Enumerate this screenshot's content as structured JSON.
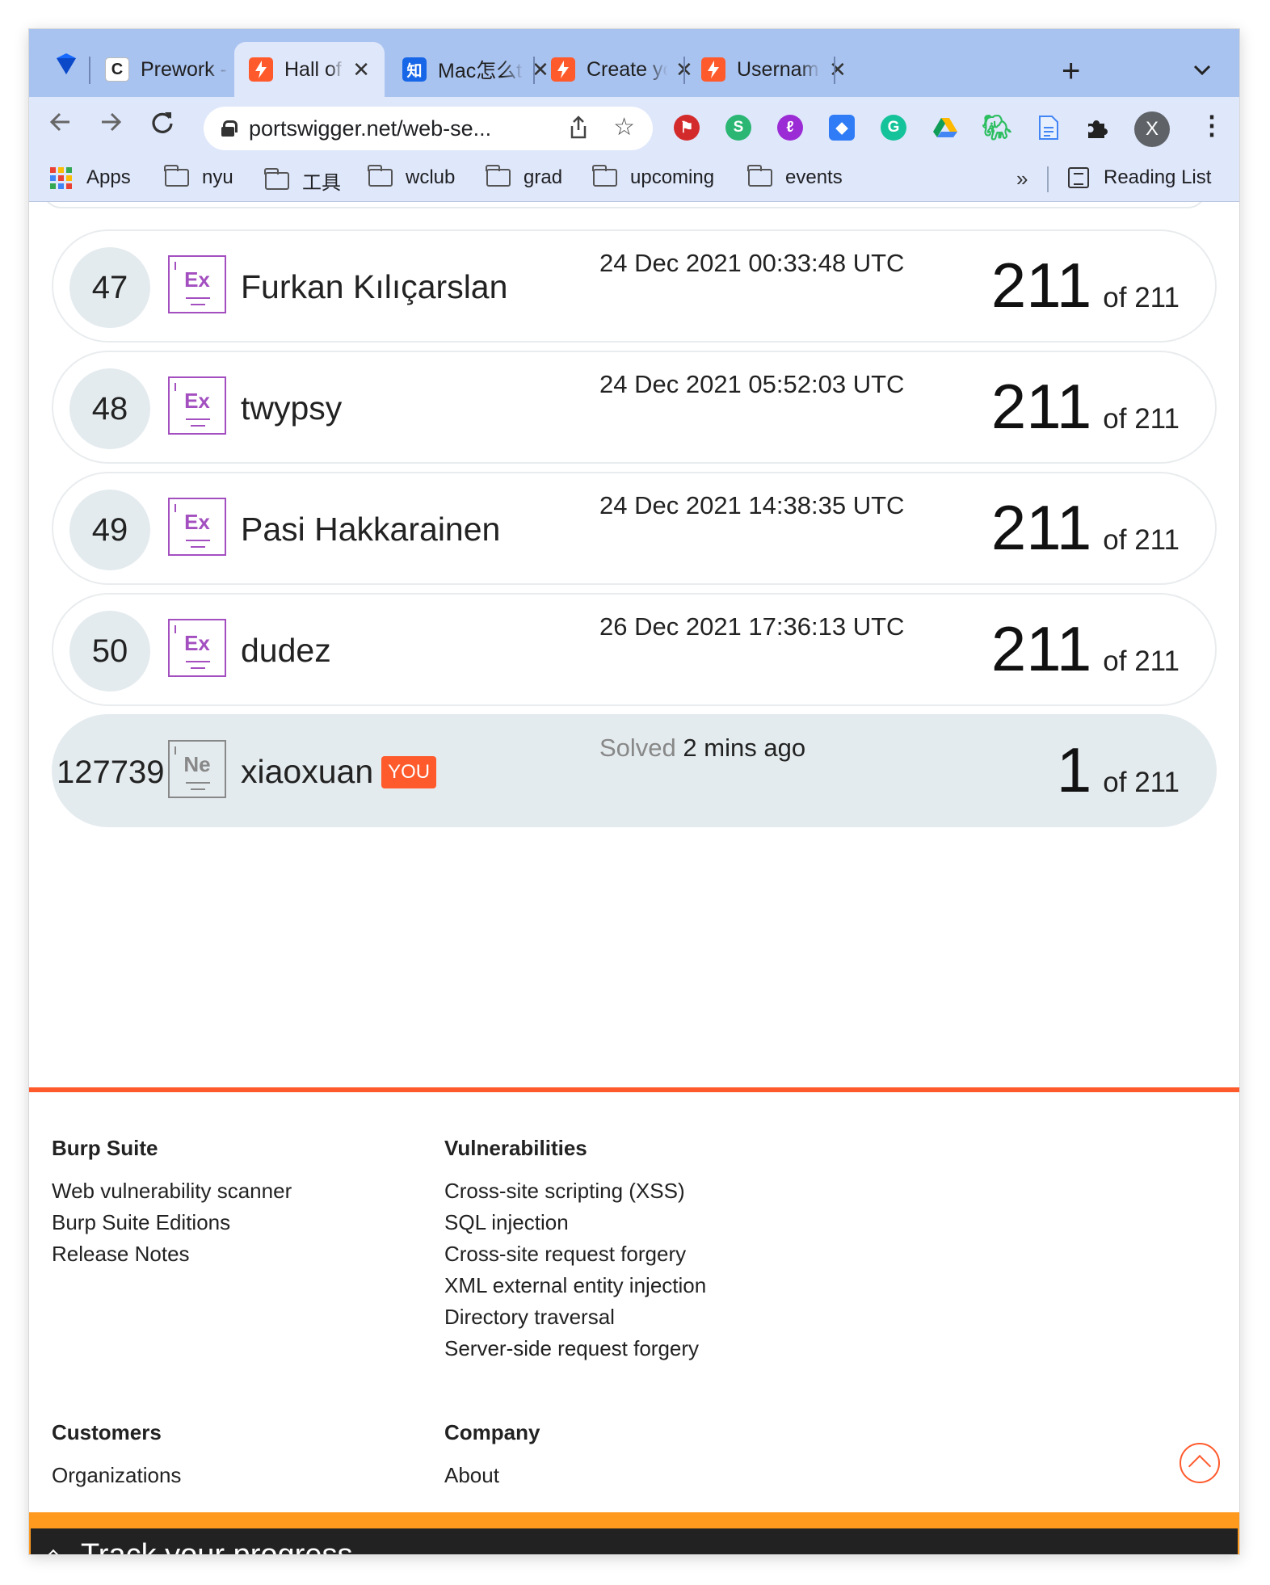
{
  "browser": {
    "tabs": [
      {
        "title": "Prework -",
        "favicon": "C"
      },
      {
        "title": "Hall of Fa",
        "favicon": "portswigger",
        "active": true
      },
      {
        "title": "Mac怎么t",
        "favicon": "知"
      },
      {
        "title": "Create yo",
        "favicon": "portswigger"
      },
      {
        "title": "Usernam",
        "favicon": "portswigger"
      }
    ],
    "new_tab": "+",
    "close": "✕",
    "url": "portswigger.net/web-se...",
    "avatar_initial": "X",
    "bookmarks": [
      "Apps",
      "nyu",
      "工具",
      "wclub",
      "grad",
      "upcoming",
      "events"
    ],
    "more": "»",
    "reading_list": "Reading List"
  },
  "leaderboard": [
    {
      "rank": "47",
      "badge": "Ex",
      "name": "Furkan Kılıçarslan",
      "date": "24 Dec 2021 00:33:48 UTC",
      "solved": "211",
      "of": "of 211"
    },
    {
      "rank": "48",
      "badge": "Ex",
      "name": "twypsy",
      "date": "24 Dec 2021 05:52:03 UTC",
      "solved": "211",
      "of": "of 211"
    },
    {
      "rank": "49",
      "badge": "Ex",
      "name": "Pasi Hakkarainen",
      "date": "24 Dec 2021 14:38:35 UTC",
      "solved": "211",
      "of": "of 211"
    },
    {
      "rank": "50",
      "badge": "Ex",
      "name": "dudez",
      "date": "26 Dec 2021 17:36:13 UTC",
      "solved": "211",
      "of": "of 211"
    }
  ],
  "me": {
    "rank": "127739",
    "badge": "Ne",
    "name": "xiaoxuan",
    "tag": "YOU",
    "solved_label": "Solved",
    "solved_when": "2 mins ago",
    "solved": "1",
    "of": "of 211"
  },
  "footer": {
    "burp": {
      "title": "Burp Suite",
      "links": [
        "Web vulnerability scanner",
        "Burp Suite Editions",
        "Release Notes"
      ]
    },
    "vulns": {
      "title": "Vulnerabilities",
      "links": [
        "Cross-site scripting (XSS)",
        "SQL injection",
        "Cross-site request forgery",
        "XML external entity injection",
        "Directory traversal",
        "Server-side request forgery"
      ]
    },
    "customers": {
      "title": "Customers",
      "links": [
        "Organizations"
      ]
    },
    "company": {
      "title": "Company",
      "links": [
        "About"
      ]
    }
  },
  "track_progress": "Track your progress",
  "colors": {
    "brand": "#ff5a2c",
    "badge_expert": "#a34fc0",
    "track_bar": "#ff9a1f"
  }
}
